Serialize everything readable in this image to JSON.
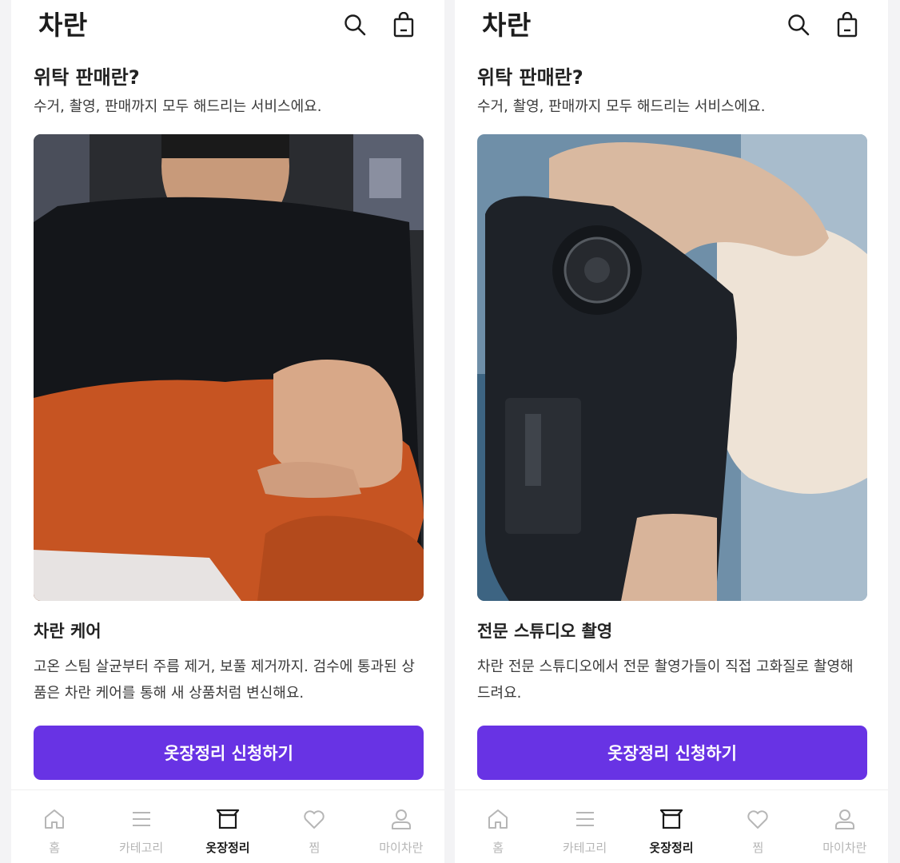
{
  "screens": [
    {
      "logo": "차란",
      "title": "위탁 판매란?",
      "subtitle": "수거, 촬영, 판매까지 모두 해드리는 서비스에요.",
      "photo": "person-folding-orange-knit-sweater",
      "card_title": "차란 케어",
      "card_desc": "고온 스팀 살균부터 주름 제거, 보풀 제거까지. 검수에 통과된 상품은 차란 케어를 통해 새 상품처럼 변신해요.",
      "cta_label": "옷장정리 신청하기"
    },
    {
      "logo": "차란",
      "title": "위탁 판매란?",
      "subtitle": "수거, 촬영, 판매까지 모두 해드리는 서비스에요.",
      "photo": "hands-holding-camera",
      "card_title": "전문 스튜디오 촬영",
      "card_desc": "차란 전문 스튜디오에서 전문 촬영가들이 직접 고화질로 촬영해 드려요.",
      "cta_label": "옷장정리 신청하기"
    }
  ],
  "header_icons": [
    "search-icon",
    "shopping-bag-icon"
  ],
  "tabs": [
    {
      "label": "홈",
      "icon": "home-icon",
      "active": false
    },
    {
      "label": "카테고리",
      "icon": "menu-icon",
      "active": false
    },
    {
      "label": "옷장정리",
      "icon": "wardrobe-box-icon",
      "active": true
    },
    {
      "label": "찜",
      "icon": "heart-icon",
      "active": false
    },
    {
      "label": "마이차란",
      "icon": "user-icon",
      "active": false
    }
  ],
  "colors": {
    "accent": "#6833e4",
    "tab_inactive": "#b6b6b6",
    "tab_active": "#1a1a1a",
    "text_primary": "#222222"
  }
}
